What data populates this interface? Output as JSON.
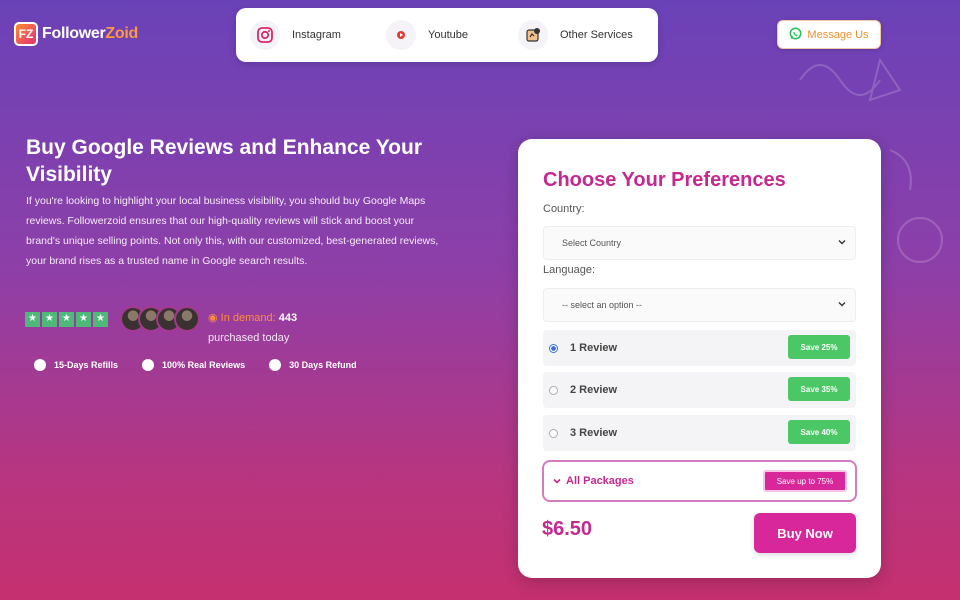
{
  "brand": {
    "name_part1": "Follower",
    "name_part2": "Zoid",
    "mark": "FZ"
  },
  "nav": {
    "items": [
      {
        "label": "Instagram",
        "icon": "instagram-icon"
      },
      {
        "label": "Youtube",
        "icon": "youtube-icon"
      },
      {
        "label": "Other Services",
        "icon": "services-icon"
      }
    ]
  },
  "header": {
    "message_label": "Message Us",
    "message_icon": "whatsapp-icon"
  },
  "hero": {
    "title": "Buy Google Reviews and Enhance Your Visibility",
    "body": "If you're looking to highlight your local business visibility, you should buy Google Maps reviews. Followerzoid ensures that our high-quality reviews will stick and boost your brand's unique selling points. Not only this, with our customized, best-generated reviews, your brand rises as a trusted name in Google search results.",
    "demand_label": "In demand:",
    "demand_count": "443",
    "demand_sub": "purchased today",
    "features": [
      "15-Days Refills",
      "100% Real Reviews",
      "30 Days Refund"
    ]
  },
  "preferences": {
    "title": "Choose Your Preferences",
    "country_label": "Country:",
    "country_value": "Select Country",
    "language_label": "Language:",
    "language_value": "-- select an option --",
    "options": [
      {
        "label": "1 Review",
        "badge": "Save 25%",
        "selected": true
      },
      {
        "label": "2 Review",
        "badge": "Save 35%",
        "selected": false
      },
      {
        "label": "3 Review",
        "badge": "Save 40%",
        "selected": false
      }
    ],
    "all_packages_label": "All Packages",
    "all_packages_badge": "Save up to 75%",
    "price": "$6.50",
    "buy_label": "Buy Now"
  },
  "colors": {
    "accent": "#c42a8e",
    "button": "#d8279a",
    "badge_green": "#4bc865",
    "star_green": "#4fb97a"
  }
}
